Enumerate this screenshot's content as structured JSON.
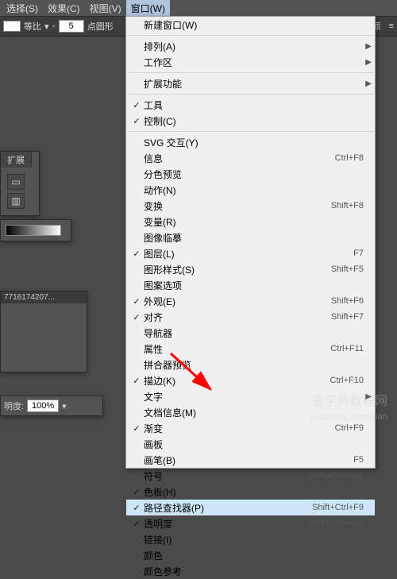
{
  "menubar": {
    "items": [
      {
        "label": "选择(S)"
      },
      {
        "label": "效果(C)"
      },
      {
        "label": "视图(V)"
      },
      {
        "label": "窗口(W)"
      }
    ],
    "open_index": 3
  },
  "toolbar": {
    "equal_label": "等比",
    "points_value": "5",
    "points_label": "点圆形",
    "right_label": "选项"
  },
  "panels": {
    "ext_tab": "扩展",
    "filename": "7716174207...",
    "opacity_label": "明度:",
    "opacity_value": "100%"
  },
  "menu": {
    "groups": [
      {
        "items": [
          {
            "label": "新建窗口(W)"
          }
        ]
      },
      {
        "items": [
          {
            "label": "排列(A)",
            "submenu": true
          },
          {
            "label": "工作区",
            "submenu": true
          }
        ]
      },
      {
        "items": [
          {
            "label": "扩展功能",
            "submenu": true
          }
        ]
      },
      {
        "items": [
          {
            "label": "工具",
            "checked": true
          },
          {
            "label": "控制(C)",
            "checked": true
          }
        ]
      },
      {
        "items": [
          {
            "label": "SVG 交互(Y)"
          },
          {
            "label": "信息",
            "shortcut": "Ctrl+F8"
          },
          {
            "label": "分色预览"
          },
          {
            "label": "动作(N)"
          },
          {
            "label": "变换",
            "shortcut": "Shift+F8"
          },
          {
            "label": "变量(R)"
          },
          {
            "label": "图像临摹"
          },
          {
            "label": "图层(L)",
            "checked": true,
            "shortcut": "F7"
          },
          {
            "label": "图形样式(S)",
            "shortcut": "Shift+F5"
          },
          {
            "label": "图案选项"
          },
          {
            "label": "外观(E)",
            "checked": true,
            "shortcut": "Shift+F6"
          },
          {
            "label": "对齐",
            "checked": true,
            "shortcut": "Shift+F7"
          },
          {
            "label": "导航器"
          },
          {
            "label": "属性",
            "shortcut": "Ctrl+F11"
          },
          {
            "label": "拼合器预览"
          },
          {
            "label": "描边(K)",
            "checked": true,
            "shortcut": "Ctrl+F10"
          },
          {
            "label": "文字",
            "submenu": true
          },
          {
            "label": "文档信息(M)"
          },
          {
            "label": "渐变",
            "checked": true,
            "shortcut": "Ctrl+F9"
          },
          {
            "label": "画板"
          },
          {
            "label": "画笔(B)",
            "shortcut": "F5"
          },
          {
            "label": "符号",
            "shortcut": "Shift+Ctrl+F11"
          },
          {
            "label": "色板(H)",
            "checked": true
          },
          {
            "label": "路径查找器(P)",
            "checked": true,
            "shortcut": "Shift+Ctrl+F9",
            "highlight": true
          },
          {
            "label": "透明度",
            "checked": true,
            "shortcut": "Shift+Ctrl+F10"
          },
          {
            "label": "链接(I)"
          },
          {
            "label": "颜色"
          },
          {
            "label": "颜色参考"
          }
        ]
      }
    ]
  },
  "watermark": {
    "line1": "查字典教程网",
    "line2": "jiaocheng.chazidian"
  }
}
